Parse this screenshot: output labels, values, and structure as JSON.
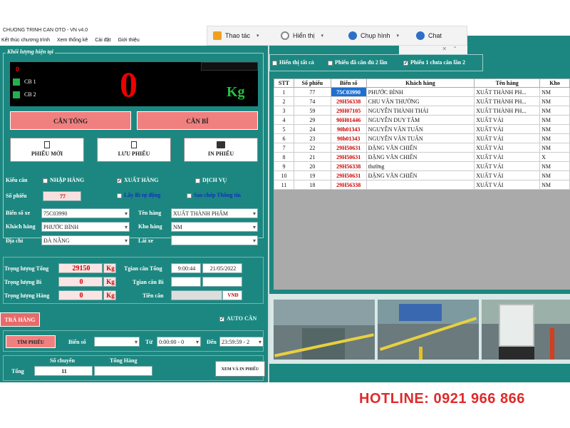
{
  "window": {
    "title": "CHUONG TRINH CAN OTO - VN v4.0"
  },
  "menu": [
    "Kết thúc chương trình",
    "Xem thống kê",
    "Cài đặt",
    "Giới thiệu"
  ],
  "floatbar": {
    "items": [
      {
        "label": "Thao tác",
        "icon": "snapshot-icon"
      },
      {
        "label": "Hiển thị",
        "icon": "gear-icon"
      },
      {
        "label": "Chụp hình",
        "icon": "camera-icon"
      },
      {
        "label": "Chat",
        "icon": "chat-icon"
      }
    ]
  },
  "weight_group": {
    "title": "Khối lượng hiện tại",
    "indicator": "0",
    "cb1": "CB 1",
    "cb2": "CB 2",
    "value": "0",
    "unit": "Kg"
  },
  "buttons": {
    "can_tong": "CÂN TỔNG",
    "can_bi": "CÂN BÌ",
    "phieu_moi": "PHIẾU MỚI",
    "luu_phieu": "LƯU PHIẾU",
    "in_phieu": "IN PHIẾU",
    "tra_hang": "TRẢ HÀNG",
    "tim_phieu": "TÌM PHIẾU",
    "xem_in": "XEM VÀ IN PHIẾU"
  },
  "form": {
    "kieu_can_label": "Kiểu cân",
    "nhap_hang": "NHẬP HÀNG",
    "xuat_hang": "XUẤT HÀNG",
    "dich_vu": "DỊCH VỤ",
    "so_phieu_label": "Số phiếu",
    "so_phieu": "77",
    "lay_bi": "Lấy Bì tự động",
    "sao_chep": "Sao chép Thông tin",
    "bien_so_label": "Biển số xe",
    "bien_so": "75C03990",
    "ten_hang_label": "Tên hàng",
    "ten_hang": "XUẤT THÀNH PHẨM",
    "khach_hang_label": "Khách hàng",
    "khach_hang": "PHƯỚC BÌNH",
    "kho_hang_label": "Kho hàng",
    "kho_hang": "NM",
    "dia_chi_label": "Địa chỉ",
    "dia_chi": "ĐÀ NẴNG",
    "lai_xe_label": "Lái xe",
    "lai_xe": ""
  },
  "weights": {
    "tl_tong_label": "Trọng lượng Tổng",
    "tl_tong": "29150",
    "tl_bi_label": "Trọng lượng Bì",
    "tl_bi": "0",
    "tl_hang_label": "Trọng lượng Hàng",
    "tl_hang": "0",
    "unit": "Kg",
    "tg_tong_label": "Tgian cân Tổng",
    "tg_tong_time": "9:00:44",
    "tg_tong_date": "21/05/2022",
    "tg_bi_label": "Tgian cân Bì",
    "tien_can_label": "Tiền cân",
    "vnd": "VNĐ"
  },
  "auto_can": "AUTO CÂN",
  "search": {
    "bien_so_label": "Biển số",
    "tu_label": "Từ",
    "tu": "0:00:00 - 0",
    "den_label": "Đến",
    "den": "23:59:59 - 2"
  },
  "totals": {
    "tong_label": "Tổng",
    "so_chuyen_label": "Số chuyến",
    "so_chuyen": "11",
    "tong_hang_label": "Tổng Hàng",
    "tong_hang": ""
  },
  "filters": {
    "hien_thi": "Hiển thị tất cả",
    "da_can": "Phiếu đã cân đủ 2 lần",
    "chua_can": "Phiếu 1 chưa cân lần 2"
  },
  "table": {
    "headers": [
      "STT",
      "Số phiếu",
      "Biển số",
      "Khách hàng",
      "Tên hàng",
      "Kho"
    ],
    "rows": [
      [
        "1",
        "77",
        "75C03990",
        "PHƯỚC BÌNH",
        "XUẤT THÀNH PH...",
        "NM"
      ],
      [
        "2",
        "74",
        "29H56338",
        "CHU VĂN THƯỜNG",
        "XUẤT THÀNH PH...",
        "NM"
      ],
      [
        "3",
        "59",
        "29H07105",
        "NGUYỄN THÀNH THÁI",
        "XUẤT THÀNH PH...",
        "NM"
      ],
      [
        "4",
        "29",
        "90H01446",
        "NGUYỄN DUY TÂM",
        "XUẤT VẢI",
        "NM"
      ],
      [
        "5",
        "24",
        "90h01343",
        "NGUYỄN VĂN TUẤN",
        "XUẤT VẢI",
        "NM"
      ],
      [
        "6",
        "23",
        "90h01343",
        "NGUYỄN VĂN TUẤN",
        "XUẤT VẢI",
        "NM"
      ],
      [
        "7",
        "22",
        "29H50631",
        "ĐẶNG VĂN CHIẾN",
        "XUẤT VẢI",
        "NM"
      ],
      [
        "8",
        "21",
        "29H50631",
        "ĐẶNG VĂN CHIẾN",
        "XUẤT VẢI",
        "X"
      ],
      [
        "9",
        "20",
        "29H56338",
        "thường",
        "XUẤT VẢI",
        "NM"
      ],
      [
        "10",
        "19",
        "29H50631",
        "ĐẶNG VĂN CHIẾN",
        "XUẤT VẢI",
        "NM"
      ],
      [
        "11",
        "18",
        "29H56338",
        "",
        "XUẤT VẢI",
        "NM"
      ]
    ]
  },
  "hotline": "HOTLINE:  0921 966 866"
}
